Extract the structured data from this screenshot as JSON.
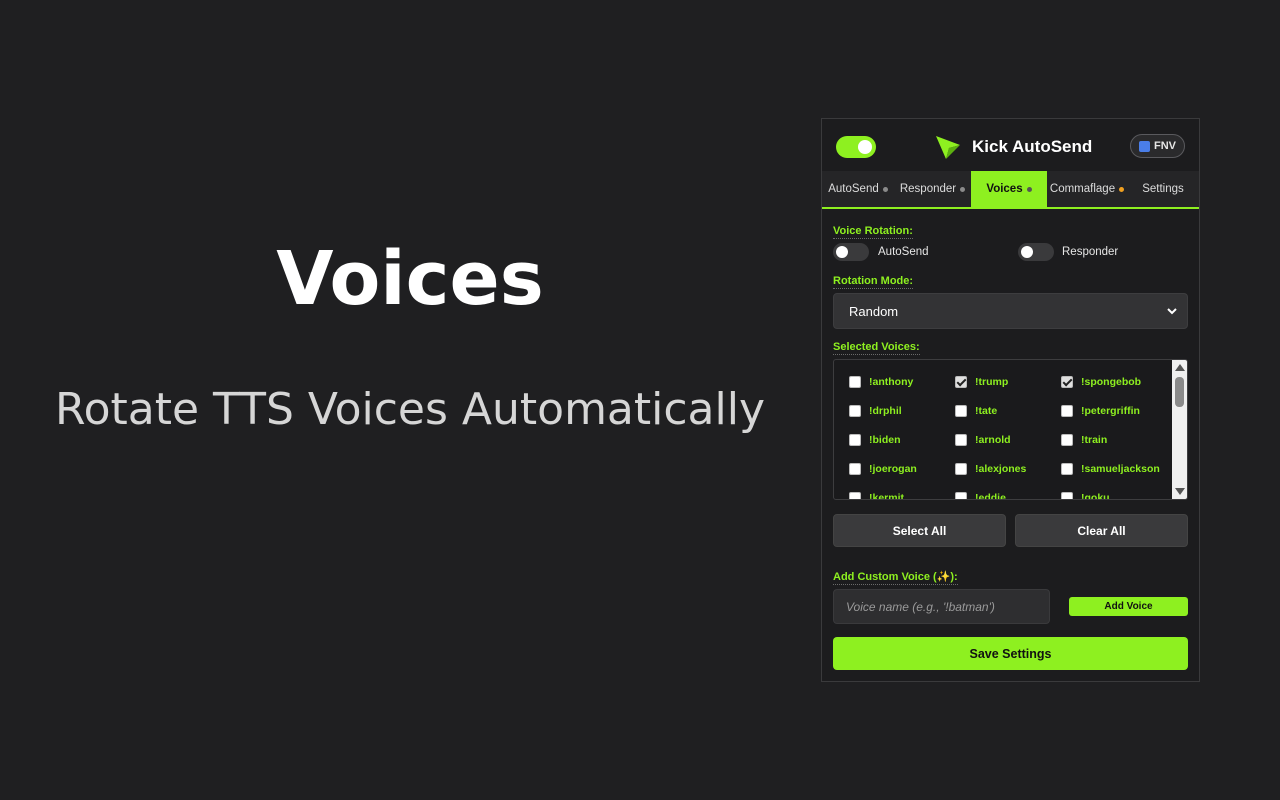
{
  "hero": {
    "title": "Voices",
    "subtitle": "Rotate TTS Voices Automatically"
  },
  "header": {
    "master_toggle_on": true,
    "app_name": "Kick AutoSend",
    "logo_icon": "paper-plane-icon",
    "badge_label": "FNV"
  },
  "tabs": [
    {
      "label": "AutoSend",
      "active": false
    },
    {
      "label": "Responder",
      "active": false
    },
    {
      "label": "Voices",
      "active": true
    },
    {
      "label": "Commaflage",
      "active": false
    },
    {
      "label": "Settings",
      "active": false
    }
  ],
  "voice_rotation": {
    "label": "Voice Rotation:",
    "autosend_label": "AutoSend",
    "responder_label": "Responder"
  },
  "rotation_mode": {
    "label": "Rotation Mode:",
    "value": "Random"
  },
  "selected_voices": {
    "label": "Selected Voices:",
    "rows": [
      [
        {
          "name": "!anthony",
          "checked": false
        },
        {
          "name": "!trump",
          "checked": true
        },
        {
          "name": "!spongebob",
          "checked": true
        }
      ],
      [
        {
          "name": "!drphil",
          "checked": false
        },
        {
          "name": "!tate",
          "checked": false
        },
        {
          "name": "!petergriffin",
          "checked": false
        }
      ],
      [
        {
          "name": "!biden",
          "checked": false
        },
        {
          "name": "!arnold",
          "checked": false
        },
        {
          "name": "!train",
          "checked": false
        }
      ],
      [
        {
          "name": "!joerogan",
          "checked": false
        },
        {
          "name": "!alexjones",
          "checked": false
        },
        {
          "name": "!samueljackson",
          "checked": false
        }
      ],
      [
        {
          "name": "!kermit",
          "checked": false
        },
        {
          "name": "!eddie",
          "checked": false
        },
        {
          "name": "!goku",
          "checked": false
        }
      ]
    ]
  },
  "buttons": {
    "select_all": "Select All",
    "clear_all": "Clear All",
    "add_voice": "Add Voice",
    "save": "Save Settings"
  },
  "custom_voice": {
    "label": "Add Custom Voice (✨):",
    "placeholder": "Voice name (e.g., '!batman')"
  },
  "colors": {
    "accent": "#8ef020",
    "background": "#1f1f21",
    "panel": "#1c1c1e"
  }
}
